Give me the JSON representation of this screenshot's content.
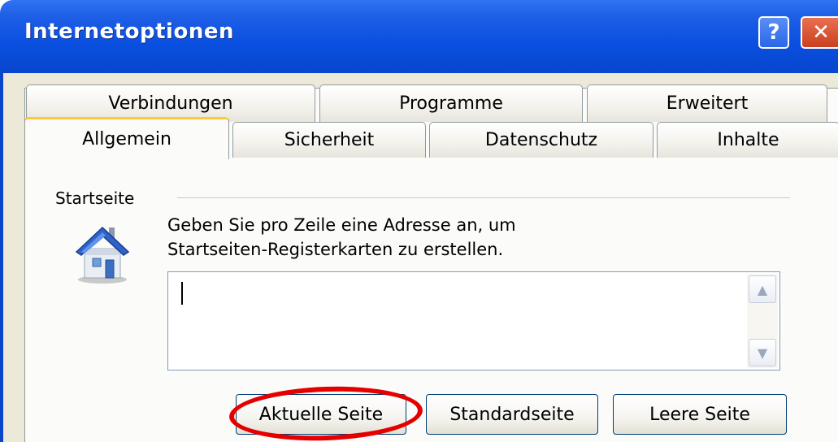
{
  "window": {
    "title": "Internetoptionen",
    "help_label": "?",
    "close_label": "✕"
  },
  "tabs": {
    "row1": [
      "Verbindungen",
      "Programme",
      "Erweitert"
    ],
    "row2": [
      "Allgemein",
      "Sicherheit",
      "Datenschutz",
      "Inhalte"
    ],
    "active": "Allgemein"
  },
  "homepage": {
    "group_label": "Startseite",
    "description_line1": "Geben Sie pro Zeile eine Adresse an, um",
    "description_line2": "Startseiten-Registerkarten zu erstellen.",
    "address_value": "",
    "icon": "house-icon",
    "buttons": {
      "current": "Aktuelle Seite",
      "default": "Standardseite",
      "blank": "Leere Seite"
    }
  },
  "colors": {
    "titlebar": "#0a4fe0",
    "dialog_bg": "#ece9d8",
    "highlight": "#e50000",
    "active_tab_accent": "#ffc83c"
  }
}
